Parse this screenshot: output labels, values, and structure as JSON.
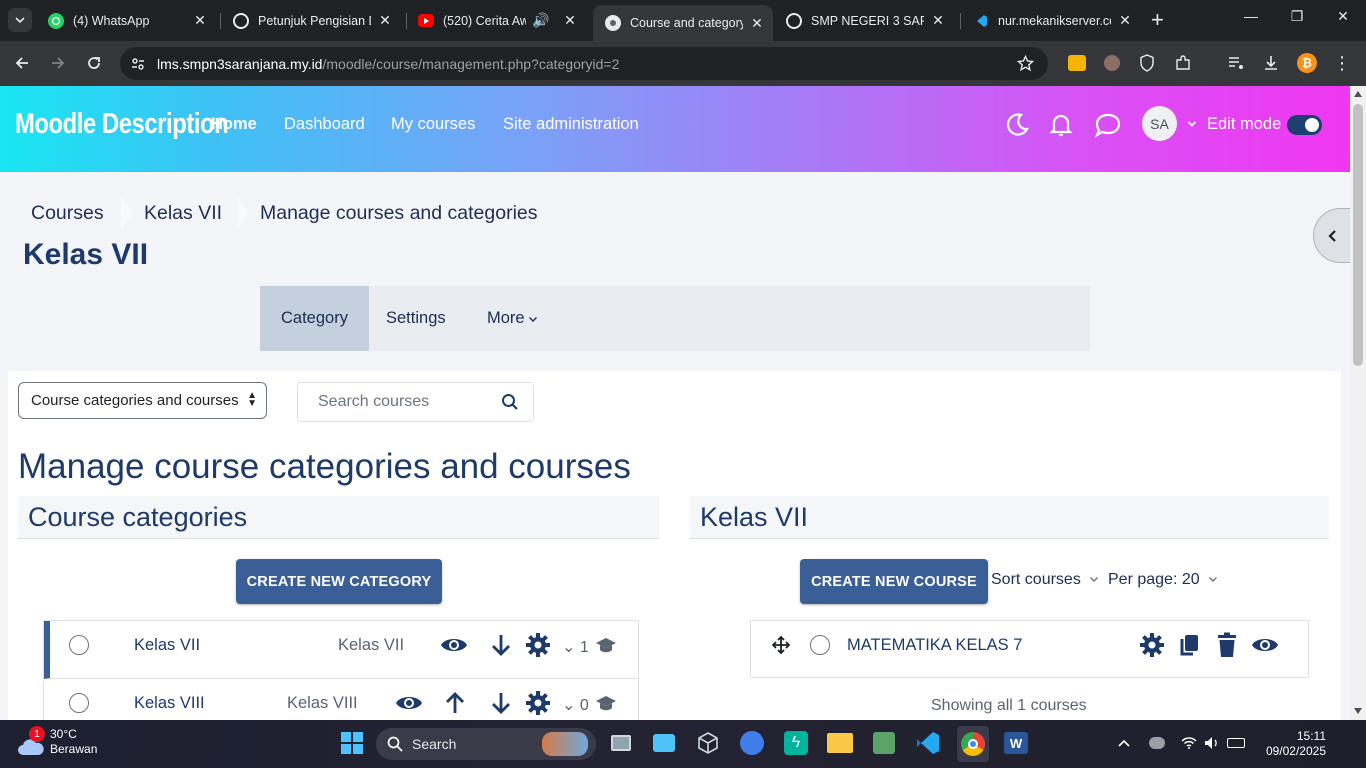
{
  "browser": {
    "tabs": [
      {
        "title": "(4) WhatsApp",
        "favicon": "whatsapp-icon"
      },
      {
        "title": "Petunjuk Pengisian Da",
        "favicon": "globe-icon"
      },
      {
        "title": "(520) Cerita Awal",
        "favicon": "youtube-icon"
      },
      {
        "title": "Course and category",
        "favicon": "moodle-icon",
        "active": true
      },
      {
        "title": "SMP NEGERI 3 SARAI",
        "favicon": "globe-icon"
      },
      {
        "title": "nur.mekanikserver.co",
        "favicon": "vscode-icon"
      }
    ],
    "url_host": "lms.smpn3saranjana.my.id",
    "url_path": "/moodle/course/management.php?categoryid=2"
  },
  "navbar": {
    "brand": "Moodle Description",
    "items": [
      "Home",
      "Dashboard",
      "My courses",
      "Site administration"
    ],
    "avatar_initials": "SA",
    "edit_mode_label": "Edit mode"
  },
  "breadcrumb": [
    "Courses",
    "Kelas VII",
    "Manage courses and categories"
  ],
  "page_title": "Kelas VII",
  "secondary_nav": [
    "Category",
    "Settings",
    "More"
  ],
  "controls": {
    "view_select": "Course categories and courses",
    "search_placeholder": "Search courses"
  },
  "main_heading": "Manage course categories and courses",
  "categories_pane": {
    "heading": "Course categories",
    "create_button": "CREATE NEW CATEGORY",
    "rows": [
      {
        "name": "Kelas VII",
        "idnumber": "Kelas VII",
        "count": "1"
      },
      {
        "name": "Kelas VIII",
        "idnumber": "Kelas VIII",
        "count": "0"
      }
    ]
  },
  "courses_pane": {
    "heading": "Kelas VII",
    "create_button": "CREATE NEW COURSE",
    "sort_label": "Sort courses",
    "per_page_label": "Per page: 20",
    "courses": [
      {
        "name": "MATEMATIKA KELAS 7"
      }
    ],
    "showing": "Showing all 1 courses"
  },
  "taskbar": {
    "weather_temp": "30°C",
    "weather_desc": "Berawan",
    "weather_badge": "1",
    "search_label": "Search",
    "time": "15:11",
    "date": "09/02/2025"
  },
  "colors": {
    "accent": "#3a5f96",
    "heading": "#1d3a6b",
    "navbar_start": "#19e6f2",
    "navbar_end": "#f036f2"
  }
}
